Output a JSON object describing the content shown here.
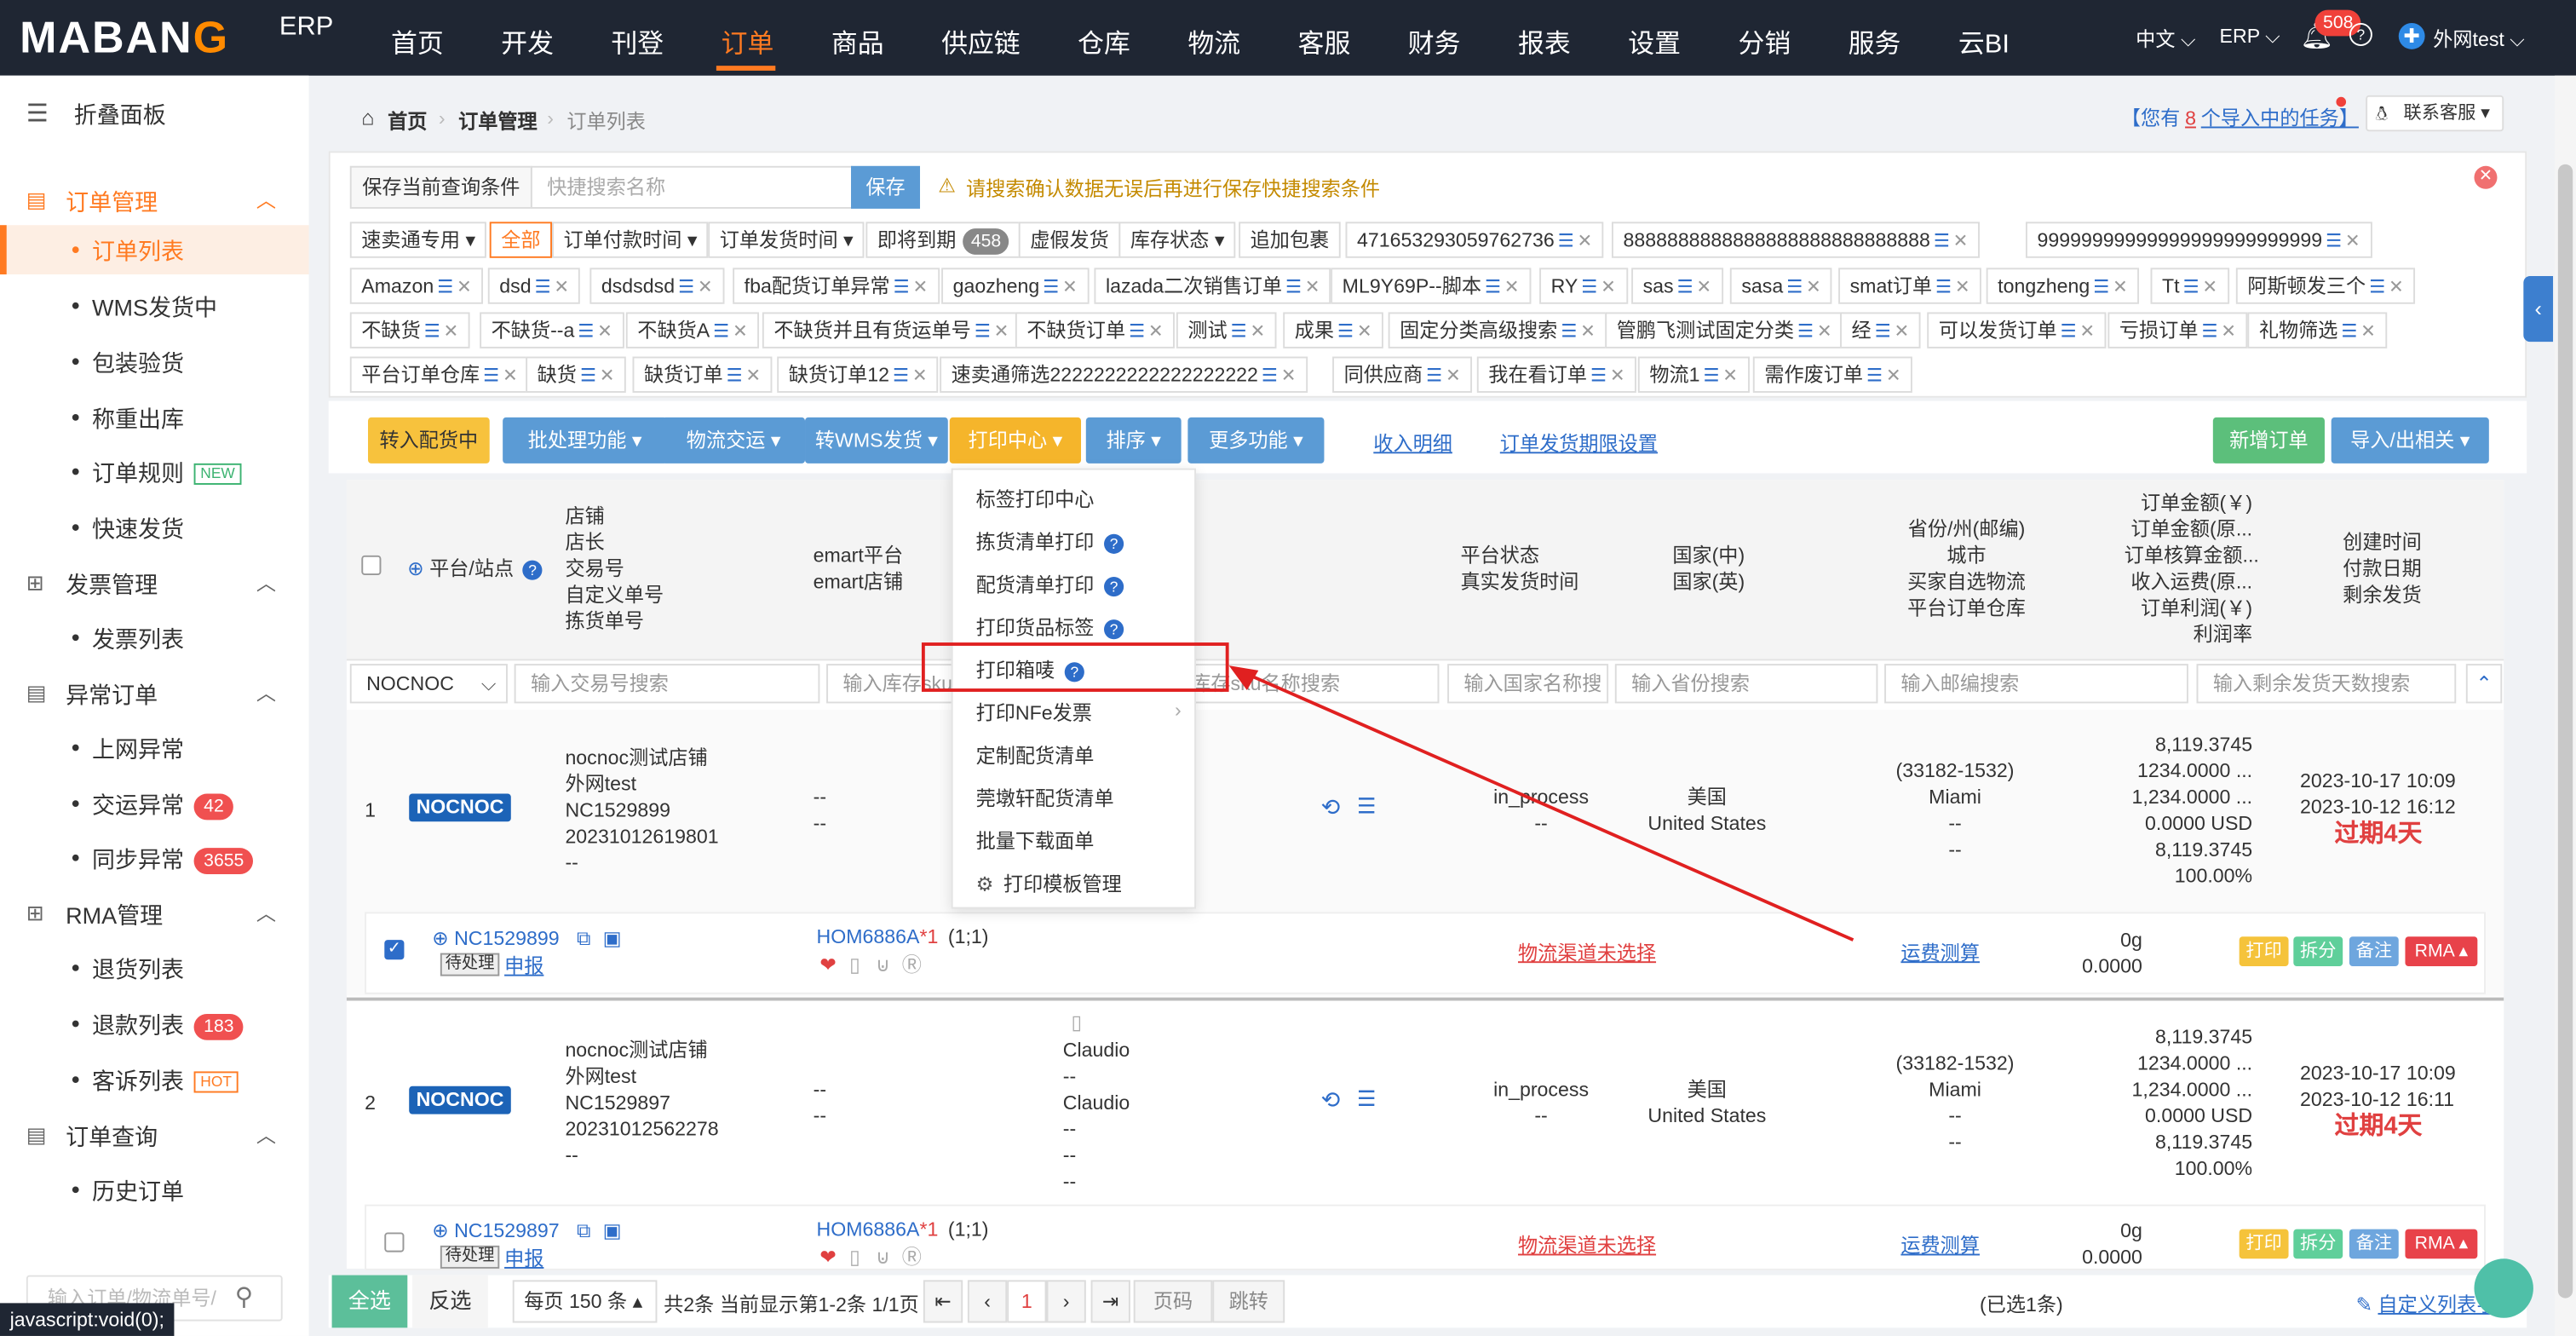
{
  "nav": {
    "logo": "MABANG",
    "logo_suffix": "ERP",
    "items": [
      "首页",
      "开发",
      "刊登",
      "订单",
      "商品",
      "供应链",
      "仓库",
      "物流",
      "客服",
      "财务",
      "报表",
      "设置",
      "分销",
      "服务",
      "云BI"
    ],
    "active": "订单",
    "lang": "中文",
    "erp": "ERP",
    "bell_count": "508",
    "user": "外网test"
  },
  "sidebar": {
    "collapse": "折叠面板",
    "groups": [
      {
        "label": "订单管理",
        "items": [
          {
            "label": "订单列表",
            "active": true
          },
          {
            "label": "WMS发货中"
          },
          {
            "label": "包装验货"
          },
          {
            "label": "称重出库"
          },
          {
            "label": "订单规则",
            "tag": "NEW"
          },
          {
            "label": "快速发货"
          }
        ]
      },
      {
        "label": "发票管理",
        "items": [
          {
            "label": "发票列表"
          }
        ]
      },
      {
        "label": "异常订单",
        "items": [
          {
            "label": "上网异常"
          },
          {
            "label": "交运异常",
            "badge": "42"
          },
          {
            "label": "同步异常",
            "badge": "3655"
          }
        ]
      },
      {
        "label": "RMA管理",
        "items": [
          {
            "label": "退货列表"
          },
          {
            "label": "退款列表",
            "badge": "183"
          },
          {
            "label": "客诉列表",
            "tag": "HOT"
          }
        ]
      },
      {
        "label": "订单查询",
        "items": [
          {
            "label": "历史订单"
          }
        ]
      }
    ],
    "search_placeholder": "输入订单/物流单号/",
    "status_bar": "javascript:void(0);"
  },
  "breadcrumb": {
    "home": "首页",
    "mid": "订单管理",
    "current": "订单列表",
    "task_prefix": "【您有",
    "task_count": "8",
    "task_suffix": "个导入中的任务】",
    "service": "联系客服"
  },
  "filter": {
    "save_label": "保存当前查询条件",
    "search_placeholder": "快捷搜索名称",
    "save_btn": "保存",
    "warning": "请搜索确认数据无误后再进行保存快捷搜索条件",
    "row1": [
      "速卖通专用",
      "全部",
      "订单付款时间",
      "订单发货时间",
      "即将到期",
      "虚假发货",
      "库存状态",
      "追加包裹",
      "471653293059762736",
      "8888888888888888888888888888",
      "99999999999999999999999999"
    ],
    "due_badge": "458",
    "row2": [
      "Amazon",
      "dsd",
      "dsdsdsd",
      "fba配货订单异常",
      "gaozheng",
      "lazada二次销售订单",
      "ML9Y69P--脚本",
      "RY",
      "sas",
      "sasa",
      "smat订单",
      "tongzheng",
      "Tt",
      "阿斯顿发三个"
    ],
    "row3": [
      "不缺货",
      "不缺货--a",
      "不缺货A",
      "不缺货并且有货运单号",
      "不缺货订单",
      "测试",
      "成果",
      "固定分类高级搜索",
      "管鹏飞测试固定分类",
      "经",
      "可以发货订单",
      "亏损订单",
      "礼物筛选"
    ],
    "row4": [
      "平台订单仓库",
      "缺货",
      "缺货订单",
      "缺货订单12",
      "速卖通筛选2222222222222222222",
      "同供应商",
      "我在看订单",
      "物流1",
      "需作废订单"
    ]
  },
  "toolbar": {
    "buttons": [
      "转入配货中",
      "批处理功能",
      "物流交运",
      "转WMS发货",
      "打印中心",
      "排序",
      "更多功能"
    ],
    "links": [
      "收入明细",
      "订单发货期限设置"
    ],
    "new_order": "新增订单",
    "import_export": "导入/出相关"
  },
  "dropdown": {
    "items": [
      "标签打印中心",
      "拣货清单打印",
      "配货清单打印",
      "打印货品标签",
      "打印箱唛",
      "打印NFe发票",
      "定制配货清单",
      "莞墩轩配货清单",
      "批量下载面单",
      "打印模板管理"
    ]
  },
  "table": {
    "headers": {
      "platform": "平台/站点",
      "shop": [
        "店铺",
        "店长",
        "交易号",
        "自定义单号",
        "拣货单号"
      ],
      "emart": [
        "emart平台",
        "emart店铺"
      ],
      "status": [
        "平台状态",
        "真实发货时间"
      ],
      "country": [
        "国家(中)",
        "国家(英)"
      ],
      "province": [
        "省份/州(邮编)",
        "城市",
        "买家自选物流",
        "平台订单仓库"
      ],
      "amount": [
        "订单金额(￥)",
        "订单金额(原...",
        "订单核算金额...",
        "收入运费(原...",
        "订单利润(￥)",
        "利润率"
      ],
      "time": [
        "创建时间",
        "付款日期",
        "剩余发货"
      ]
    },
    "filters": {
      "platform_value": "NOCNOC",
      "trade_no": "输入交易号搜索",
      "sku": "输入库存sku",
      "sku_name": "库存sku名称搜索",
      "country": "输入国家名称搜",
      "province": "输入省份搜索",
      "zip": "输入邮编搜索",
      "remaining": "输入剩余发货天数搜索"
    },
    "rows": [
      {
        "index": "1",
        "platform": "NOCNOC",
        "shop": "nocnoc测试店铺",
        "manager": "外网test",
        "trade": "NC1529899",
        "custom": "20231012619801",
        "pick": "--",
        "emart": [
          "--",
          "--"
        ],
        "status": "in_process",
        "status2": "--",
        "country_cn": "美国",
        "country_en": "United States",
        "zip": "(33182-1532)",
        "city": "Miami",
        "logistics": "--",
        "warehouse": "--",
        "amounts": [
          "8,119.3745",
          "1234.0000 ...",
          "1,234.0000 ...",
          "0.0000 USD",
          "8,119.3745",
          "100.00%"
        ],
        "created": "2023-10-17 10:09",
        "paid": "2023-10-12 16:12",
        "expired": "过期4天",
        "order_id": "NC1529899",
        "pending": "待处理",
        "declare": "申报",
        "sku": "HOM6886A",
        "sku_qty": "*1",
        "sku_ratio": "(1;1)",
        "logistics_link": "物流渠道未选择",
        "fee_link": "运费测算",
        "weight": "0g",
        "weight_amount": "0.0000"
      },
      {
        "index": "2",
        "platform": "NOCNOC",
        "shop": "nocnoc测试店铺",
        "manager": "外网test",
        "trade": "NC1529897",
        "custom": "20231012562278",
        "pick": "--",
        "emart": [
          "--",
          "--"
        ],
        "extra": [
          "Claudio",
          "--",
          "Claudio",
          "--",
          "--",
          "--"
        ],
        "status": "in_process",
        "status2": "--",
        "country_cn": "美国",
        "country_en": "United States",
        "zip": "(33182-1532)",
        "city": "Miami",
        "logistics": "--",
        "warehouse": "--",
        "amounts": [
          "8,119.3745",
          "1234.0000 ...",
          "1,234.0000 ...",
          "0.0000 USD",
          "8,119.3745",
          "100.00%"
        ],
        "created": "2023-10-17 10:09",
        "paid": "2023-10-12 16:11",
        "expired": "过期4天",
        "order_id": "NC1529897",
        "pending": "待处理",
        "declare": "申报",
        "sku": "HOM6886A",
        "sku_qty": "*1",
        "sku_ratio": "(1;1)",
        "logistics_link": "物流渠道未选择",
        "fee_link": "运费测算",
        "weight": "0g",
        "weight_amount": "0.0000"
      }
    ],
    "action_buttons": [
      "打印",
      "拆分",
      "备注",
      "RMA"
    ]
  },
  "footer": {
    "select_all": "全选",
    "invert": "反选",
    "per_page": "每页 150 条",
    "summary": "共2条 当前显示第1-2条 1/1页",
    "current_page": "1",
    "page_input": "页码",
    "jump": "跳转",
    "selected": "(已选1条)",
    "selected_count": "1",
    "custom_columns": "自定义列表字段"
  },
  "colors": {
    "accent": "#ff7a21",
    "nav_bg": "#1f2633",
    "blue_btn": "#5b9bd5",
    "link": "#2e6dc9",
    "danger": "#e04040"
  }
}
